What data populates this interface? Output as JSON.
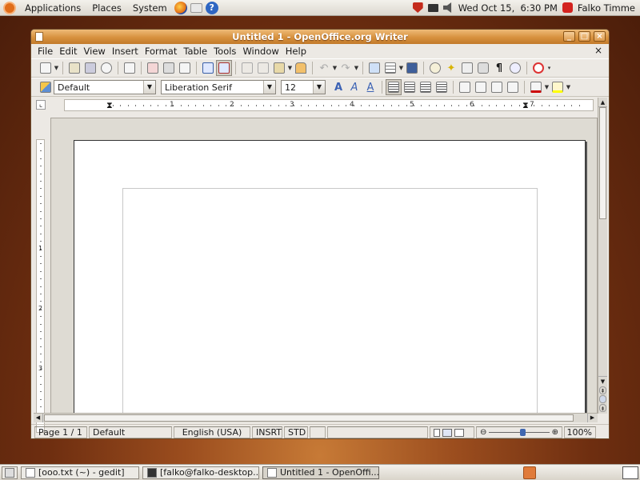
{
  "top_panel": {
    "menus": [
      "Applications",
      "Places",
      "System"
    ],
    "clock": "Wed Oct 15,  6:30 PM",
    "user": "Falko Timme"
  },
  "window": {
    "title": "Untitled 1 - OpenOffice.org Writer",
    "menu": [
      "File",
      "Edit",
      "View",
      "Insert",
      "Format",
      "Table",
      "Tools",
      "Window",
      "Help"
    ],
    "close_doc": "×"
  },
  "formatting": {
    "style": "Default",
    "font": "Liberation Serif",
    "size": "12"
  },
  "ruler": {
    "h_numbers": [
      "1",
      "2",
      "3",
      "4",
      "5",
      "6",
      "7"
    ],
    "v_numbers": [
      "1",
      "2",
      "3"
    ]
  },
  "status": {
    "page": "Page 1 / 1",
    "style": "Default",
    "language": "English (USA)",
    "insert_mode": "INSRT",
    "selection_mode": "STD",
    "zoom": "100%",
    "zoom_level": 0.55
  },
  "taskbar": {
    "tasks": [
      "[ooo.txt (~) - gedit]",
      "[falko@falko-desktop...",
      "Untitled 1 - OpenOffi..."
    ]
  },
  "colors": {
    "title_gradient": "#d7913e",
    "desktop": "#9b4d1e"
  }
}
